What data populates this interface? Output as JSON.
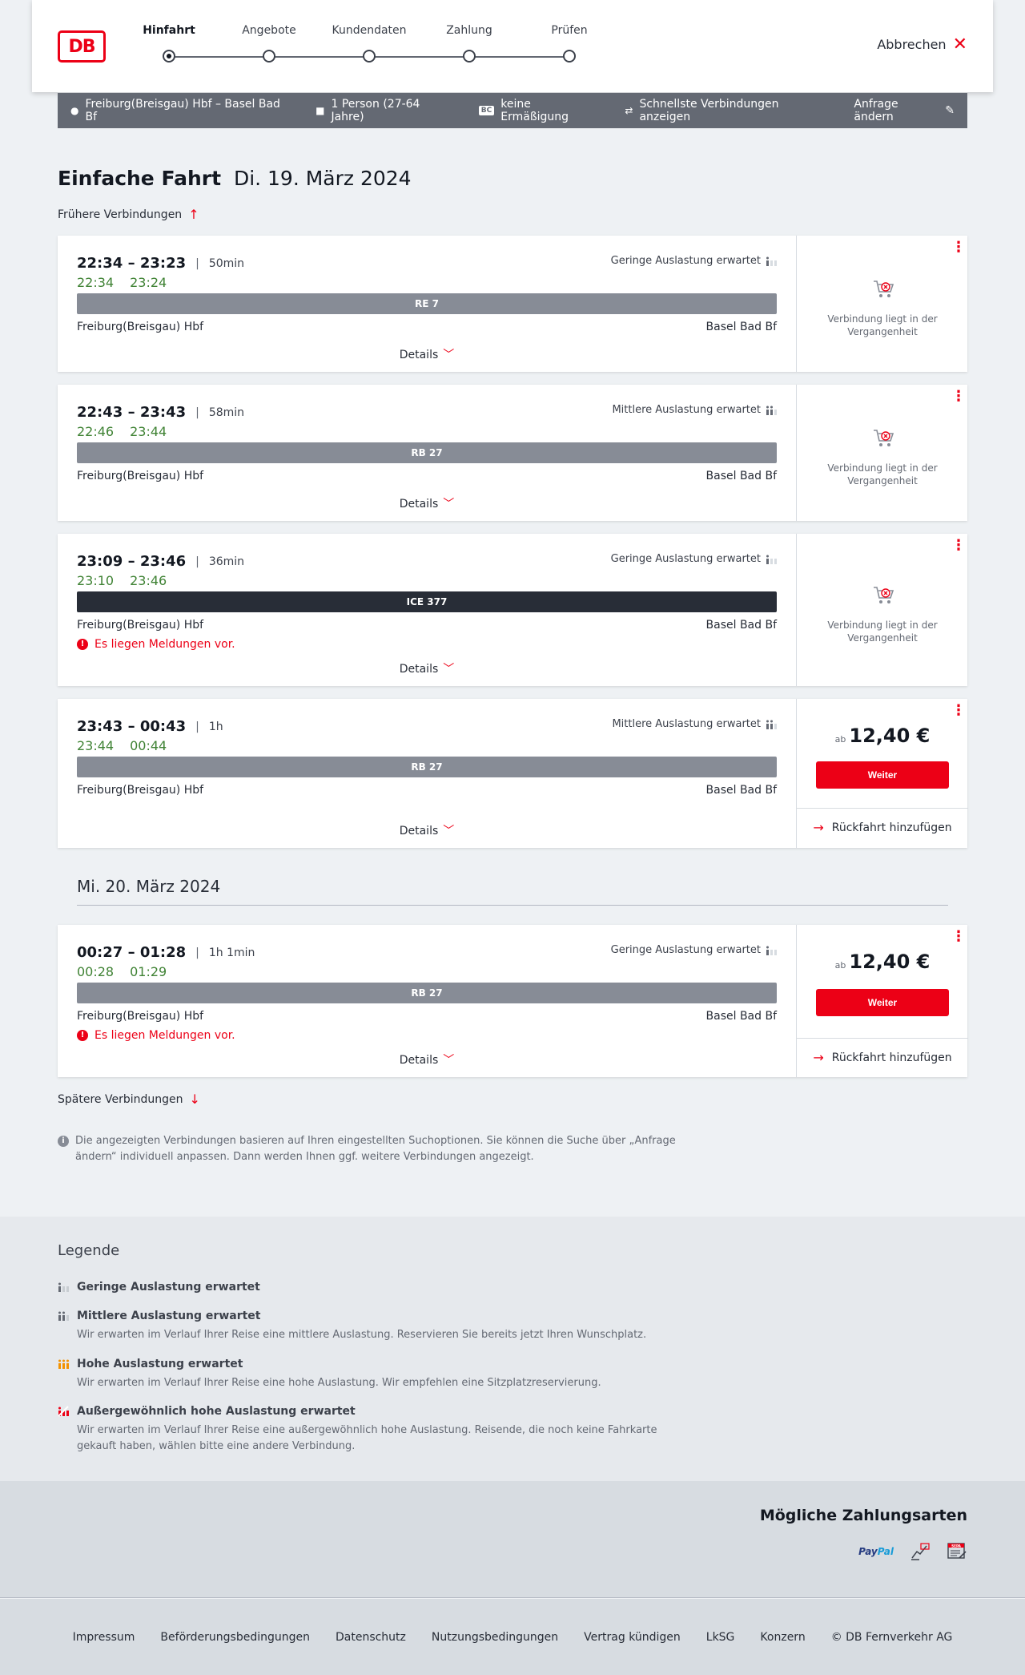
{
  "brand": {
    "logo_text": "DB",
    "accent": "#ec0016"
  },
  "stepper": {
    "steps": [
      {
        "label": "Hinfahrt"
      },
      {
        "label": "Angebote"
      },
      {
        "label": "Kundendaten"
      },
      {
        "label": "Zahlung"
      },
      {
        "label": "Prüfen"
      }
    ],
    "active_index": 0
  },
  "cancel_label": "Abbrechen",
  "search": {
    "route": "Freiburg(Breisgau) Hbf – Basel Bad Bf",
    "travellers": "1 Person (27-64 Jahre)",
    "discount_badge": "BC",
    "discount": "keine Ermäßigung",
    "option": "Schnellste Verbindungen anzeigen",
    "edit": "Anfrage ändern"
  },
  "page_title": {
    "bold": "Einfache Fahrt",
    "date": "Di. 19. März 2024"
  },
  "earlier": "Frühere Verbindungen",
  "later": "Spätere Verbindungen",
  "common": {
    "from": "Freiburg(Breisgau) Hbf",
    "to": "Basel Bad Bf",
    "details": "Details",
    "past": "Verbindung liegt in der Vergangenheit",
    "warning": "Es liegen Meldungen vor.",
    "price_prefix": "ab",
    "weiter": "Weiter",
    "return": "Rückfahrt hinzufügen"
  },
  "connections": [
    {
      "times": "22:34 – 23:23",
      "dur": "50min",
      "rt_dep": "22:34",
      "rt_arr": "23:24",
      "load": "Geringe Auslastung erwartet",
      "train": "RE 7"
    },
    {
      "times": "22:43 – 23:43",
      "dur": "58min",
      "rt_dep": "22:46",
      "rt_arr": "23:44",
      "load": "Mittlere Auslastung erwartet",
      "train": "RB 27"
    },
    {
      "times": "23:09 – 23:46",
      "dur": "36min",
      "rt_dep": "23:10",
      "rt_arr": "23:46",
      "load": "Geringe Auslastung erwartet",
      "train": "ICE 377"
    },
    {
      "times": "23:43 – 00:43",
      "dur": "1h",
      "rt_dep": "23:44",
      "rt_arr": "00:44",
      "load": "Mittlere Auslastung erwartet",
      "train": "RB 27",
      "price": "12,40 €"
    },
    {
      "times": "00:27 – 01:28",
      "dur": "1h 1min",
      "rt_dep": "00:28",
      "rt_arr": "01:29",
      "load": "Geringe Auslastung erwartet",
      "train": "RB 27",
      "price": "12,40 €"
    }
  ],
  "day_separator": "Mi. 20. März 2024",
  "info_text": "Die angezeigten Verbindungen basieren auf Ihren eingestellten Suchoptionen. Sie können die Suche über „Anfrage ändern“ individuell anpassen. Dann werden Ihnen ggf. weitere Verbindungen angezeigt.",
  "legend": {
    "title": "Legende",
    "items": [
      {
        "title": "Geringe Auslastung erwartet",
        "desc": ""
      },
      {
        "title": "Mittlere Auslastung erwartet",
        "desc": "Wir erwarten im Verlauf Ihrer Reise eine mittlere Auslastung. Reservieren Sie bereits jetzt Ihren Wunschplatz."
      },
      {
        "title": "Hohe Auslastung erwartet",
        "desc": "Wir erwarten im Verlauf Ihrer Reise eine hohe Auslastung. Wir empfehlen eine Sitzplatzreservierung."
      },
      {
        "title": "Außergewöhnlich hohe Auslastung erwartet",
        "desc": "Wir erwarten im Verlauf Ihrer Reise eine außergewöhnlich hohe Auslastung. Reisende, die noch keine Fahrkarte gekauft haben, wählen bitte eine andere Verbindung."
      }
    ]
  },
  "payment": {
    "title": "Mögliche Zahlungsarten",
    "paypal_a": "Pay",
    "paypal_b": "Pal",
    "sepa": "SEPA"
  },
  "footer": [
    "Impressum",
    "Beförderungsbedingungen",
    "Datenschutz",
    "Nutzungsbedingungen",
    "Vertrag kündigen",
    "LkSG",
    "Konzern",
    "© DB Fernverkehr AG"
  ],
  "colors": {
    "realtime": "#408335",
    "bar": "#878c96",
    "bar_ice": "#282d37",
    "load_high": "#f39200"
  }
}
